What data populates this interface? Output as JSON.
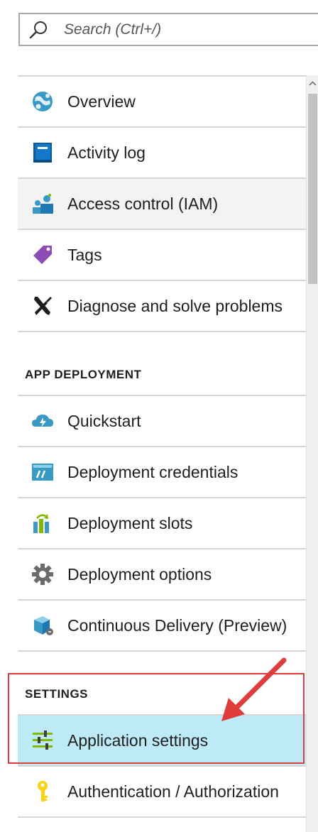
{
  "search": {
    "placeholder": "Search (Ctrl+/)"
  },
  "menu": {
    "items": [
      {
        "label": "Overview",
        "icon": "globe-icon"
      },
      {
        "label": "Activity log",
        "icon": "book-icon"
      },
      {
        "label": "Access control (IAM)",
        "icon": "users-icon"
      },
      {
        "label": "Tags",
        "icon": "tag-icon"
      },
      {
        "label": "Diagnose and solve problems",
        "icon": "tools-icon"
      }
    ],
    "deployment_header": "APP DEPLOYMENT",
    "deployment_items": [
      {
        "label": "Quickstart",
        "icon": "cloud-icon"
      },
      {
        "label": "Deployment credentials",
        "icon": "credentials-icon"
      },
      {
        "label": "Deployment slots",
        "icon": "slots-icon"
      },
      {
        "label": "Deployment options",
        "icon": "gear-icon"
      },
      {
        "label": "Continuous Delivery (Preview)",
        "icon": "cube-icon"
      }
    ],
    "settings_header": "SETTINGS",
    "settings_items": [
      {
        "label": "Application settings",
        "icon": "sliders-icon"
      },
      {
        "label": "Authentication / Authorization",
        "icon": "key-icon"
      }
    ]
  },
  "colors": {
    "selected_bg": "#bdeaf6",
    "hover_bg": "#f3f3f3",
    "annotation": "#e03c3c",
    "azure_blue": "#0072c6"
  }
}
